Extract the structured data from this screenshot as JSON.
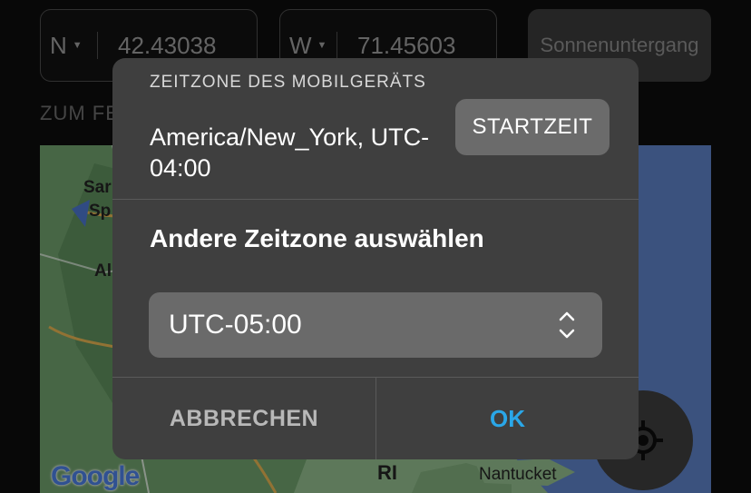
{
  "coordinates": {
    "latitude": {
      "hemisphere": "N",
      "value": "42.43038"
    },
    "longitude": {
      "hemisphere": "W",
      "value": "71.45603"
    }
  },
  "sunset_button_label": "Sonnenuntergang",
  "section_label": "ZUM FE",
  "map": {
    "labels": [
      "Sar",
      "Sp",
      "Al",
      "RI",
      "Nantucket"
    ],
    "provider_logo": "Google",
    "locate_icon": "crosshair-icon"
  },
  "dialog": {
    "device_timezone_caption": "ZEITZONE DES MOBILGERÄTS",
    "device_timezone_value": "America/New_York, UTC-04:00",
    "start_time_button": "STARTZEIT",
    "other_timezone_heading": "Andere Zeitzone auswählen",
    "selected_timezone": "UTC-05:00",
    "cancel_button": "ABBRECHEN",
    "ok_button": "OK"
  },
  "colors": {
    "accent": "#2aa7e8",
    "dialog_bg": "#3f3f3f"
  }
}
